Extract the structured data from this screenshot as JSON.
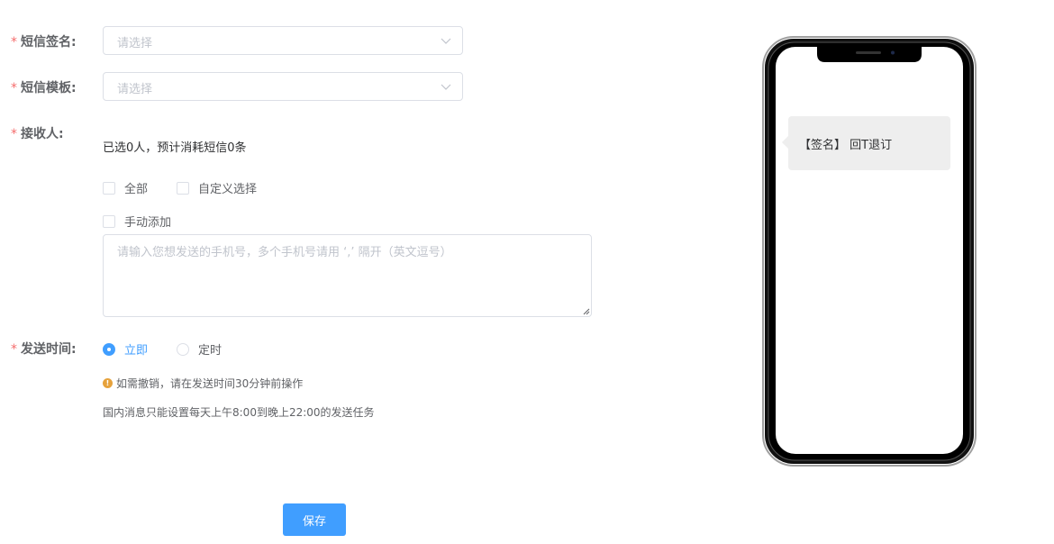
{
  "form": {
    "signature": {
      "label": "短信签名:",
      "placeholder": "请选择"
    },
    "template": {
      "label": "短信模板:",
      "placeholder": "请选择"
    },
    "recipients": {
      "label": "接收人:",
      "summary": "已选0人，预计消耗短信0条",
      "options": [
        "全部",
        "自定义选择"
      ],
      "manual_label": "手动添加",
      "textarea_placeholder": "请输入您想发送的手机号，多个手机号请用 ‘,’ 隔开（英文逗号）"
    },
    "send_time": {
      "label": "发送时间:",
      "options": [
        "立即",
        "定时"
      ],
      "selected": "立即",
      "warning_icon_text": "!",
      "warning": "如需撤销，请在发送时间30分钟前操作",
      "note": "国内消息只能设置每天上午8:00到晚上22:00的发送任务"
    },
    "save_label": "保存"
  },
  "preview": {
    "message": "【签名】 回T退订"
  },
  "colors": {
    "primary": "#409eff",
    "required": "#f56c6c",
    "warning": "#e6a23c",
    "border": "#dcdfe6",
    "placeholder": "#c0c4cc",
    "bubble": "#eeeeee"
  },
  "icons": {
    "select_arrow": "chevron-down-icon",
    "warning": "warning-icon",
    "resize": "resize-grip-icon"
  }
}
